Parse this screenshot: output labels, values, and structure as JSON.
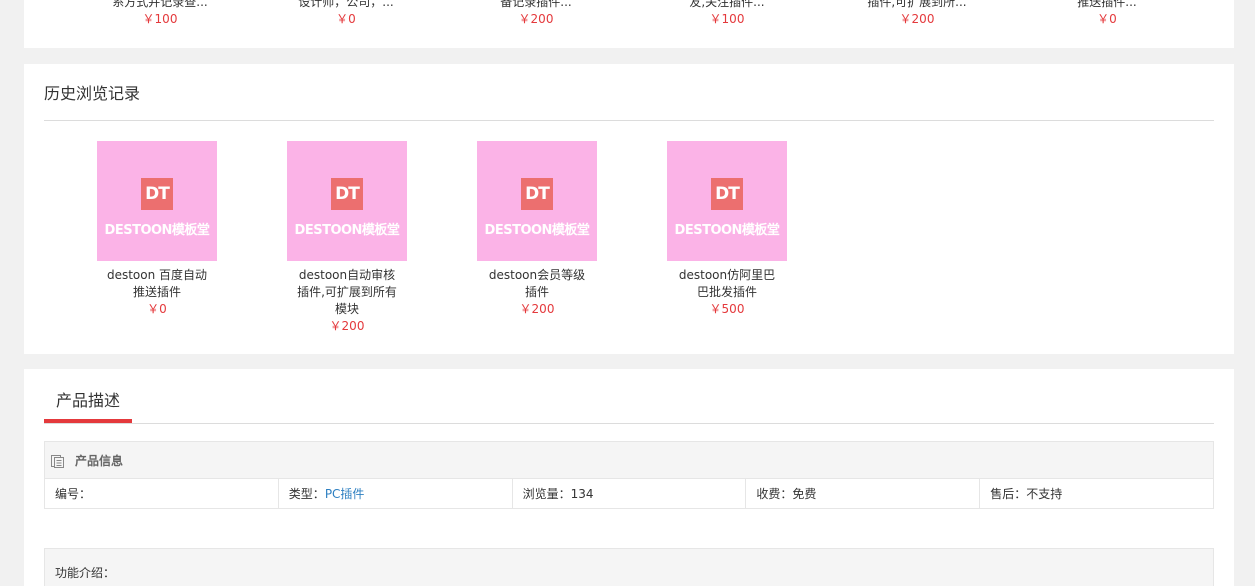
{
  "top_strip": {
    "items": [
      {
        "name": "系方式并记录查...",
        "price": "￥100"
      },
      {
        "name": "设计师，公司，...",
        "price": "￥0"
      },
      {
        "name": "备记录插件...",
        "price": "￥200"
      },
      {
        "name": "友,关注插件...",
        "price": "￥100"
      },
      {
        "name": "插件,可扩展到所...",
        "price": "￥200"
      },
      {
        "name": "推送插件...",
        "price": "￥0"
      }
    ]
  },
  "history": {
    "title": "历史浏览记录",
    "thumb_logo": "DT",
    "thumb_brand": "DESTOON模板堂",
    "items": [
      {
        "name": "destoon 百度自动推送插件",
        "price": "￥0"
      },
      {
        "name": "destoon自动审核插件,可扩展到所有模块",
        "price": "￥200"
      },
      {
        "name": "destoon会员等级插件",
        "price": "￥200"
      },
      {
        "name": "destoon仿阿里巴巴批发插件",
        "price": "￥500"
      }
    ]
  },
  "description": {
    "tab_label": "产品描述",
    "info_header": "产品信息",
    "number_label": "编号：",
    "type_label": "类型：",
    "type_value": "PC插件",
    "views_label": "浏览量：",
    "views_value": "134",
    "fee_label": "收费：",
    "fee_value": "免费",
    "aftersale_label": "售后：",
    "aftersale_value": "不支持",
    "features_label": "功能介绍："
  },
  "colors": {
    "price": "#e4393c",
    "link": "#2d7fc1",
    "thumb_bg": "#fbb3e7",
    "accent": "#e4393c"
  }
}
